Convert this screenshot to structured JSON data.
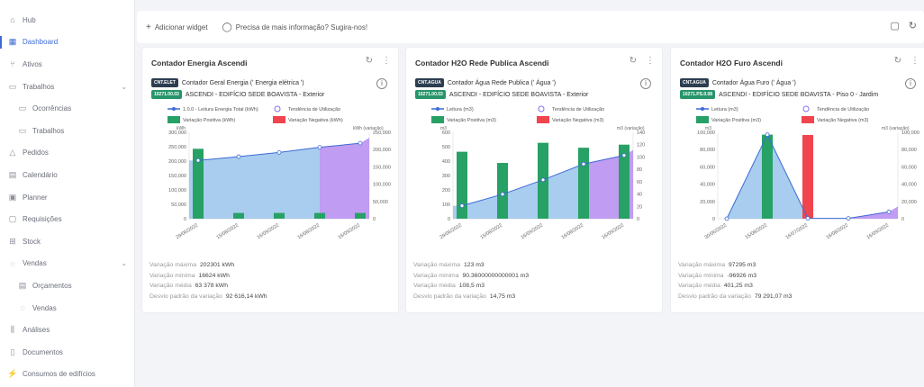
{
  "sidebar": {
    "items": [
      {
        "label": "Hub",
        "icon": "home-icon",
        "glyph": "⌂",
        "sub": false,
        "active": false,
        "chevron": false
      },
      {
        "label": "Dashboard",
        "icon": "dashboard-icon",
        "glyph": "▦",
        "sub": false,
        "active": true,
        "chevron": false
      },
      {
        "label": "Ativos",
        "icon": "assets-icon",
        "glyph": "⑂",
        "sub": false,
        "active": false,
        "chevron": false
      },
      {
        "label": "Trabalhos",
        "icon": "briefcase-icon",
        "glyph": "▭",
        "sub": false,
        "active": false,
        "chevron": true
      },
      {
        "label": "Ocorrências",
        "icon": "occurrences-icon",
        "glyph": "▭",
        "sub": true,
        "active": false,
        "chevron": false
      },
      {
        "label": "Trabalhos",
        "icon": "briefcase-icon",
        "glyph": "▭",
        "sub": true,
        "active": false,
        "chevron": false
      },
      {
        "label": "Pedidos",
        "icon": "alert-icon",
        "glyph": "△",
        "sub": false,
        "active": false,
        "chevron": false
      },
      {
        "label": "Calendário",
        "icon": "calendar-icon",
        "glyph": "▤",
        "sub": false,
        "active": false,
        "chevron": false
      },
      {
        "label": "Planner",
        "icon": "planner-icon",
        "glyph": "▣",
        "sub": false,
        "active": false,
        "chevron": false
      },
      {
        "label": "Requisições",
        "icon": "requests-icon",
        "glyph": "▢",
        "sub": false,
        "active": false,
        "chevron": false
      },
      {
        "label": "Stock",
        "icon": "stock-icon",
        "glyph": "⊞",
        "sub": false,
        "active": false,
        "chevron": false
      },
      {
        "label": "Vendas",
        "icon": "sales-icon",
        "glyph": "◌",
        "sub": false,
        "active": false,
        "chevron": true
      },
      {
        "label": "Orçamentos",
        "icon": "quotes-icon",
        "glyph": "▤",
        "sub": true,
        "active": false,
        "chevron": false
      },
      {
        "label": "Vendas",
        "icon": "sales-icon",
        "glyph": "◌",
        "sub": true,
        "active": false,
        "chevron": false
      },
      {
        "label": "Análises",
        "icon": "analytics-icon",
        "glyph": "⫼",
        "sub": false,
        "active": false,
        "chevron": false
      },
      {
        "label": "Documentos",
        "icon": "documents-icon",
        "glyph": "▯",
        "sub": false,
        "active": false,
        "chevron": false
      },
      {
        "label": "Consumos de edifícios",
        "icon": "consumption-icon",
        "glyph": "⚡",
        "sub": false,
        "active": false,
        "chevron": false
      }
    ]
  },
  "topbar": {
    "add_widget": "Adicionar widget",
    "help": "Precisa de mais informação? Sugira-nos!"
  },
  "colors": {
    "accent": "#3d6ad6",
    "bar_green": "#27a165",
    "bar_red": "#f0444e",
    "area_blue": "#8bbce8",
    "area_purple": "#b58cf0",
    "line_blue": "#3d6ad6"
  },
  "chart_data": [
    {
      "type": "bar",
      "title": "Contador Energia Ascendi",
      "tag1": "CNT.ELET",
      "counter_name": "Contador Geral Energia (' Energia elétrica ')",
      "tag2": "10271.00.03",
      "location": "ASCENDI - EDIFÍCIO SEDE BOAVISTA - Exterior",
      "legend": [
        "1.0.0 - Leitura Energia Total (kWh)",
        "Tendência de Utilização",
        "Variação Positiva (kWh)",
        "Variação Negativa (kWh)"
      ],
      "y_left_unit": "kWh",
      "y_right_unit": "kWh (variação)",
      "categories": [
        "29/06/2022",
        "15/08/2022",
        "16/09/2022",
        "16/08/2022",
        "16/09/2022"
      ],
      "ylim": [
        0,
        300000
      ],
      "y2lim": [
        0,
        250000
      ],
      "yticks": [
        "300,000",
        "250,000",
        "200,000",
        "150,000",
        "100,000",
        "50,000",
        "0"
      ],
      "y2ticks": [
        "250,000",
        "200,000",
        "150,000",
        "100,000",
        "50,000",
        "0"
      ],
      "readings": [
        202301,
        215500,
        230000,
        248000,
        262000
      ],
      "bars_positive": [
        202301,
        16624,
        16624,
        16624,
        16624
      ],
      "bars_negative": [],
      "stats": [
        {
          "label": "Variação máxima",
          "value": "202301 kWh"
        },
        {
          "label": "Variação mínima",
          "value": "16624 kWh"
        },
        {
          "label": "Variação média",
          "value": "63 378 kWh"
        },
        {
          "label": "Desvio padrão da variação",
          "value": "92 616,14 kWh"
        }
      ]
    },
    {
      "type": "bar",
      "title": "Contador H2O Rede Publica Ascendi",
      "tag1": "CNT.AGUA",
      "counter_name": "Contador Água Rede Publica (' Água ')",
      "tag2": "10271.00.03",
      "location": "ASCENDI - EDIFÍCIO SEDE BOAVISTA - Exterior",
      "legend": [
        "Leitura (m3)",
        "Tendência de Utilização",
        "Variação Positiva (m3)",
        "Variação Negativa (m3)"
      ],
      "y_left_unit": "m3",
      "y_right_unit": "m3 (variação)",
      "categories": [
        "29/06/2022",
        "15/08/2022",
        "16/09/2022",
        "16/08/2022",
        "16/09/2022"
      ],
      "ylim": [
        0,
        600
      ],
      "y2lim": [
        0,
        140
      ],
      "yticks": [
        "600",
        "500",
        "400",
        "300",
        "200",
        "100",
        "0"
      ],
      "y2ticks": [
        "140",
        "120",
        "100",
        "80",
        "60",
        "40",
        "20",
        "0"
      ],
      "readings": [
        90,
        170,
        270,
        380,
        440
      ],
      "bars_positive": [
        108.5,
        90.36,
        123,
        115,
        120
      ],
      "bars_negative": [],
      "stats": [
        {
          "label": "Variação máxima",
          "value": "123 m3"
        },
        {
          "label": "Variação mínima",
          "value": "90.36000000000001 m3"
        },
        {
          "label": "Variação média",
          "value": "108,5 m3"
        },
        {
          "label": "Desvio padrão da variação",
          "value": "14,75 m3"
        }
      ]
    },
    {
      "type": "bar",
      "title": "Contador H2O Furo Ascendi",
      "tag1": "CNT.AGUA",
      "counter_name": "Contador Água Furo (' Água ')",
      "tag2": "10271.PS.0.08",
      "location": "ASCENDI - EDIFÍCIO SEDE BOAVISTA - Piso 0 - Jardim",
      "legend": [
        "Leitura (m3)",
        "Tendência de Utilização",
        "Variação Positiva (m3)",
        "Variação Negativa (m3)"
      ],
      "y_left_unit": "m3",
      "y_right_unit": "m3 (variação)",
      "categories": [
        "30/06/2022",
        "15/08/2022",
        "16/07/2022",
        "16/08/2022",
        "16/09/2022"
      ],
      "ylim": [
        0,
        100000
      ],
      "y2lim": [
        0,
        100000
      ],
      "yticks": [
        "100,000",
        "80,000",
        "60,000",
        "40,000",
        "20,000",
        "0"
      ],
      "y2ticks": [
        "100,000",
        "80,000",
        "60,000",
        "40,000",
        "20,000",
        "0"
      ],
      "readings": [
        0,
        97295,
        369,
        369,
        8000
      ],
      "bars_positive": [
        0,
        97295,
        0,
        0,
        0
      ],
      "bars_negative": [
        0,
        0,
        96926,
        0,
        0
      ],
      "stats": [
        {
          "label": "Variação máxima",
          "value": "97295 m3"
        },
        {
          "label": "Variação mínima",
          "value": "-96926 m3"
        },
        {
          "label": "Variação média",
          "value": "401,25 m3"
        },
        {
          "label": "Desvio padrão da variação",
          "value": "79 291,07 m3"
        }
      ]
    }
  ]
}
